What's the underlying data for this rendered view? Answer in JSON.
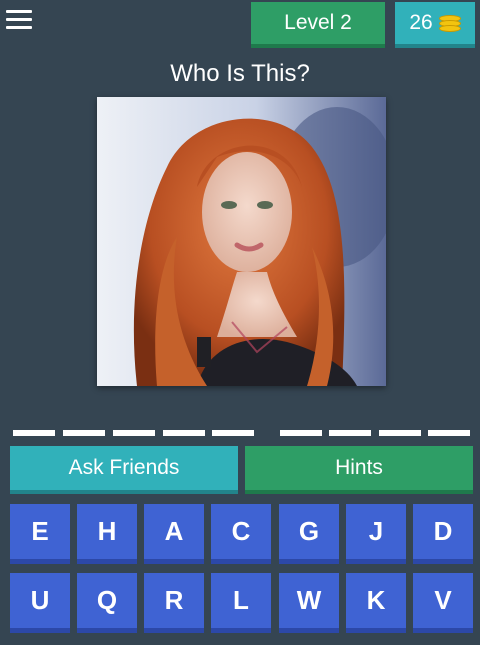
{
  "header": {
    "menu_icon": "hamburger-menu-icon",
    "level_label": "Level 2",
    "coins": "26",
    "coin_icon": "coin-stack-icon"
  },
  "question": "Who Is This?",
  "image": {
    "description_icon": "portrait-photo"
  },
  "answer": {
    "slots_word1": 5,
    "slots_word2": 4
  },
  "actions": {
    "ask_friends": "Ask Friends",
    "hints": "Hints"
  },
  "keyboard": {
    "row1": [
      "E",
      "H",
      "A",
      "C",
      "G",
      "J",
      "D"
    ],
    "row2": [
      "U",
      "Q",
      "R",
      "L",
      "W",
      "K",
      "V"
    ]
  },
  "colors": {
    "background": "#354552",
    "green": "#2e9e66",
    "teal": "#31b1ba",
    "key_blue": "#3f63d3"
  }
}
